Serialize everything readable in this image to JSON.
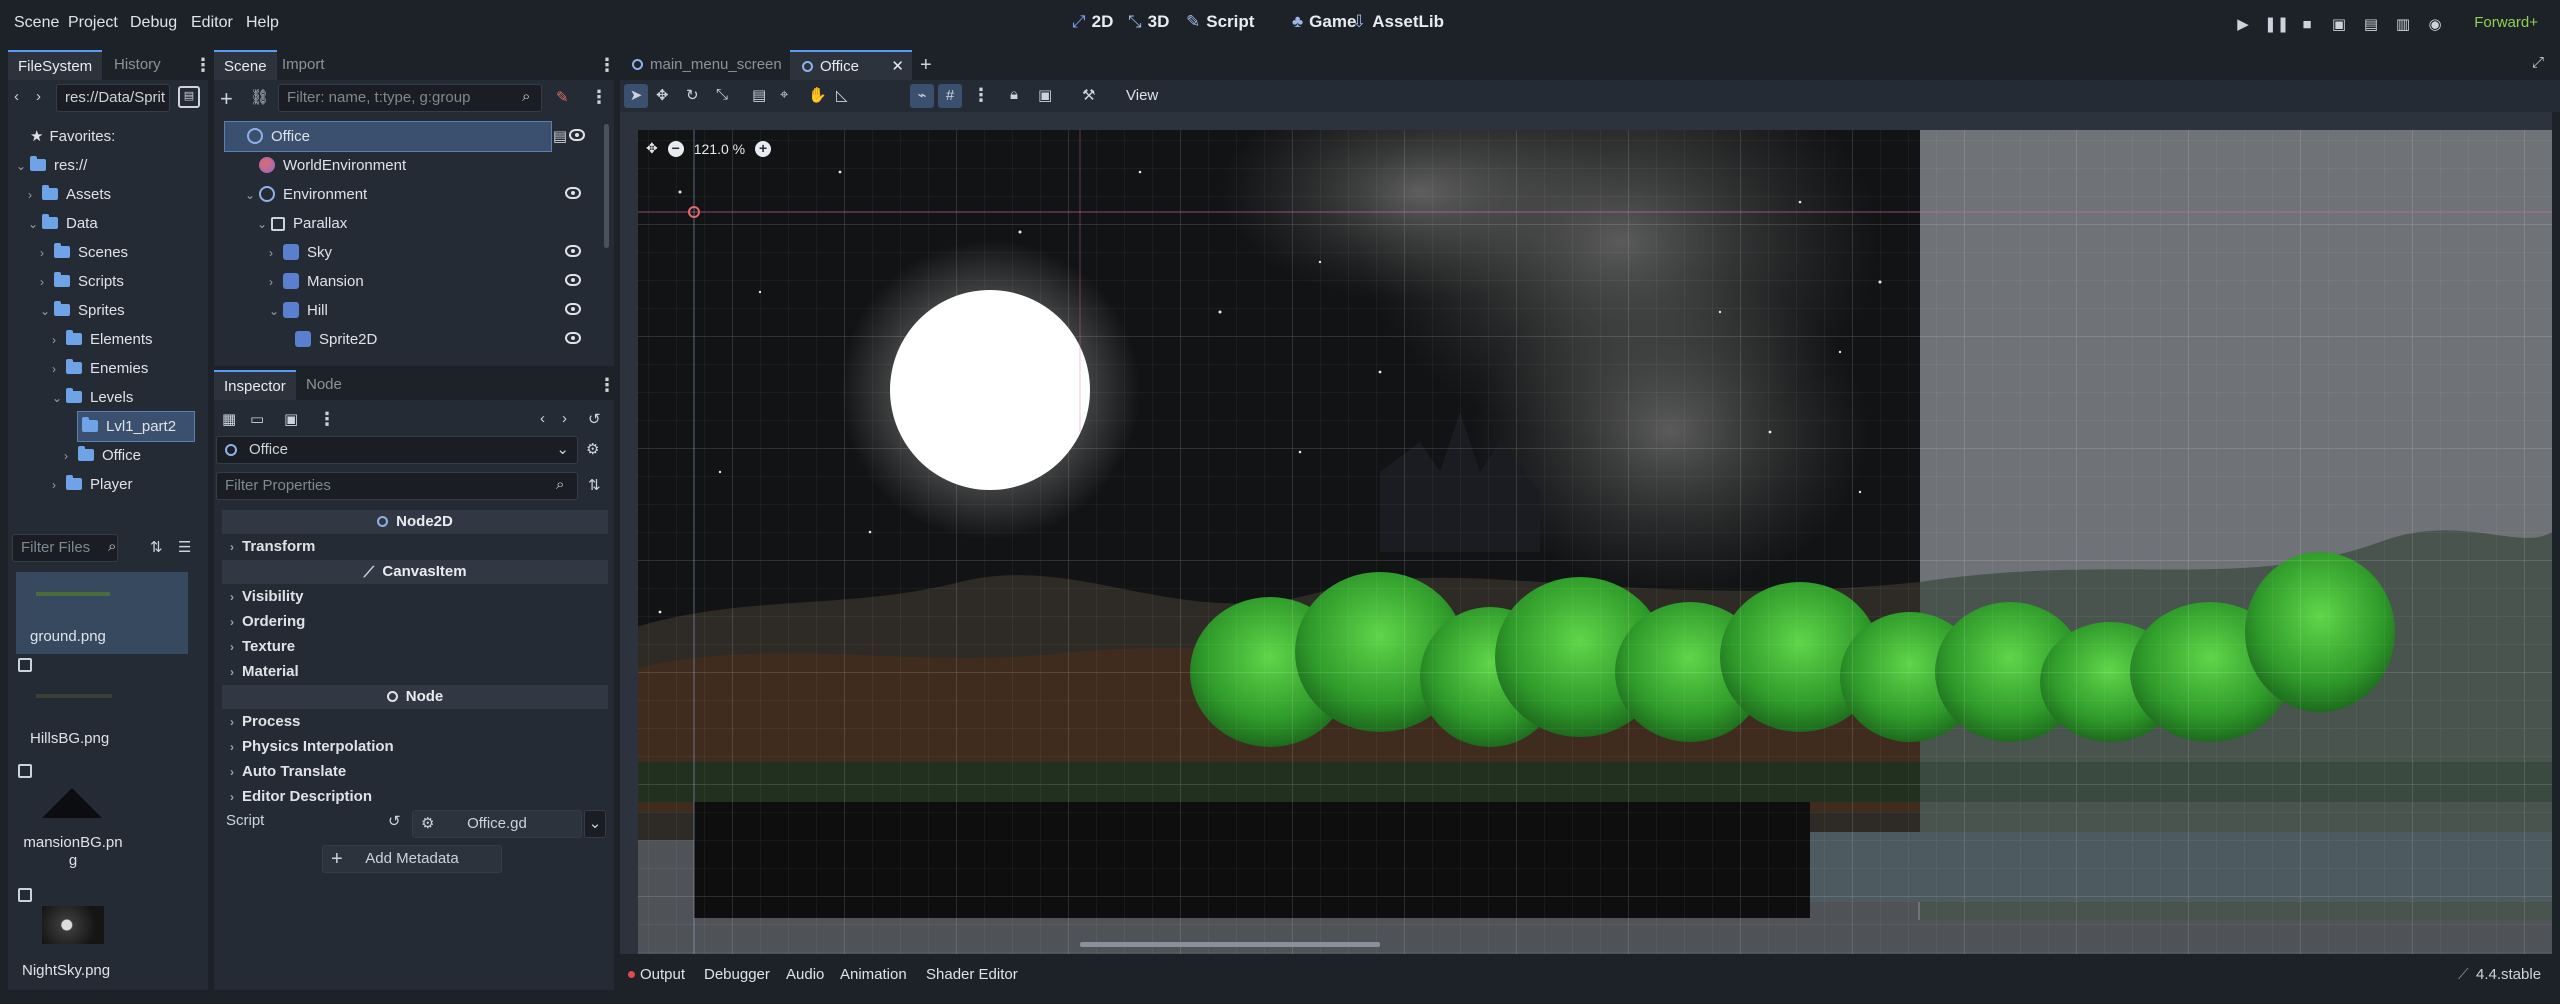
{
  "menu": [
    "Scene",
    "Project",
    "Debug",
    "Editor",
    "Help"
  ],
  "modes": [
    {
      "label": "2D",
      "glyph": "⤢",
      "active": true
    },
    {
      "label": "3D",
      "glyph": "⤡"
    },
    {
      "label": "Script",
      "glyph": "✎"
    },
    {
      "label": "Game",
      "glyph": "♣"
    },
    {
      "label": "AssetLib",
      "glyph": "⇩"
    }
  ],
  "renderer": "Forward+",
  "filesystem": {
    "tabs": [
      "FileSystem",
      "History"
    ],
    "path": "res://Data/Sprit",
    "favorites": "Favorites:",
    "tree": [
      {
        "label": "res://",
        "depth": 0,
        "open": true
      },
      {
        "label": "Assets",
        "depth": 1,
        "open": false
      },
      {
        "label": "Data",
        "depth": 1,
        "open": true
      },
      {
        "label": "Scenes",
        "depth": 2,
        "open": false
      },
      {
        "label": "Scripts",
        "depth": 2,
        "open": false
      },
      {
        "label": "Sprites",
        "depth": 2,
        "open": true
      },
      {
        "label": "Elements",
        "depth": 3,
        "open": false
      },
      {
        "label": "Enemies",
        "depth": 3,
        "open": false
      },
      {
        "label": "Levels",
        "depth": 3,
        "open": true
      },
      {
        "label": "Lvl1_part2",
        "depth": 4,
        "selected": true
      },
      {
        "label": "Office",
        "depth": 4,
        "open": false
      },
      {
        "label": "Player",
        "depth": 3,
        "open": false
      }
    ],
    "filter_placeholder": "Filter Files",
    "files": [
      "ground.png",
      "HillsBG.png",
      "mansionBG.pn\ng",
      "NightSky.png"
    ]
  },
  "scene": {
    "tabs": [
      "Scene",
      "Import"
    ],
    "filter_placeholder": "Filter: name, t:type, g:group",
    "nodes": [
      {
        "label": "Office",
        "depth": 0,
        "icon": "node2d",
        "selected": true,
        "eye": true
      },
      {
        "label": "WorldEnvironment",
        "depth": 1,
        "icon": "world",
        "eye": false
      },
      {
        "label": "Environment",
        "depth": 1,
        "icon": "node2d",
        "open": true,
        "eye": true
      },
      {
        "label": "Parallax",
        "depth": 2,
        "icon": "parallax",
        "open": true,
        "eye": false
      },
      {
        "label": "Sky",
        "depth": 3,
        "icon": "sprite",
        "closed": true,
        "eye": true
      },
      {
        "label": "Mansion",
        "depth": 3,
        "icon": "sprite",
        "closed": true,
        "eye": true
      },
      {
        "label": "Hill",
        "depth": 3,
        "icon": "sprite",
        "open": true,
        "eye": true
      },
      {
        "label": "Sprite2D",
        "depth": 4,
        "icon": "sprite",
        "eye": true
      }
    ]
  },
  "inspector": {
    "tabs": [
      "Inspector",
      "Node"
    ],
    "object": "Office",
    "filter_placeholder": "Filter Properties",
    "sections": [
      {
        "type": "head",
        "label": "Node2D"
      },
      {
        "type": "row",
        "label": "Transform"
      },
      {
        "type": "head",
        "label": "CanvasItem"
      },
      {
        "type": "row",
        "label": "Visibility"
      },
      {
        "type": "row",
        "label": "Ordering"
      },
      {
        "type": "row",
        "label": "Texture"
      },
      {
        "type": "row",
        "label": "Material"
      },
      {
        "type": "head",
        "label": "Node"
      },
      {
        "type": "row",
        "label": "Process"
      },
      {
        "type": "row",
        "label": "Physics Interpolation"
      },
      {
        "type": "row",
        "label": "Auto Translate"
      },
      {
        "type": "row",
        "label": "Editor Description"
      }
    ],
    "script_label": "Script",
    "script_value": "Office.gd",
    "add_metadata": "Add Metadata"
  },
  "editor_tabs": [
    {
      "label": "main_menu_screen",
      "active": false
    },
    {
      "label": "Office",
      "active": true
    }
  ],
  "toolbar": {
    "view": "View"
  },
  "viewport": {
    "zoom": "121.0 %"
  },
  "bottom": {
    "tabs": [
      "Output",
      "Debugger",
      "Audio",
      "Animation",
      "Shader Editor"
    ],
    "version": "4.4.stable"
  }
}
